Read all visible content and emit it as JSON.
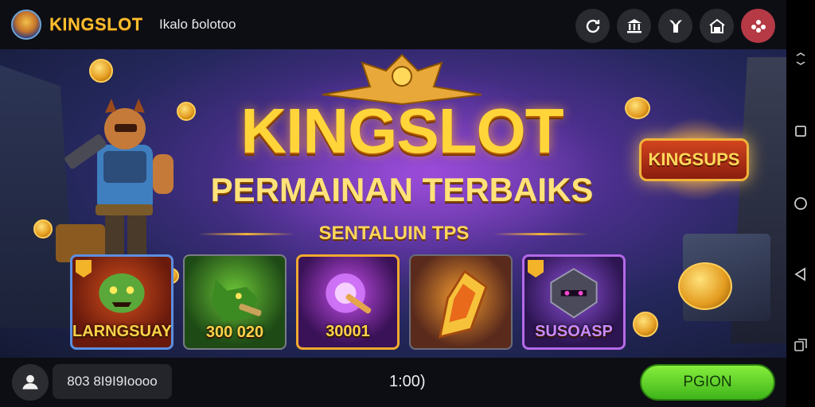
{
  "header": {
    "brand": "KINGSLOT",
    "subtitle": "Ikalo ɓolotoo",
    "icons": [
      "refresh-icon",
      "bank-icon",
      "gift-icon",
      "home-icon",
      "chat-icon"
    ]
  },
  "banner": {
    "title": "KINGSLOT",
    "subtitle": "PERMAINAN TERBAIKS",
    "ribbon": "SENTALUIN TPS",
    "badge": "KINGSUPS"
  },
  "cards": [
    {
      "label": "LARNGSUAY",
      "icon": "monster-icon"
    },
    {
      "label": "300 020",
      "icon": "dragon-icon"
    },
    {
      "label": "30001",
      "icon": "magic-orb-icon"
    },
    {
      "label": "",
      "icon": "fire-shield-icon"
    },
    {
      "label": "SUSOASP",
      "icon": "dark-knight-icon"
    }
  ],
  "footer": {
    "account": "803 8I9I9Ioooo",
    "timer": "1:00)",
    "play_label": "PGION"
  },
  "android_nav": [
    "rotate-icon",
    "square-icon",
    "circle-icon",
    "back-icon",
    "recent-apps-icon"
  ],
  "colors": {
    "brand": "#ffbe2e",
    "play": "#5ad12a",
    "bar": "#0d0e13",
    "chat_button": "#b53a46"
  }
}
